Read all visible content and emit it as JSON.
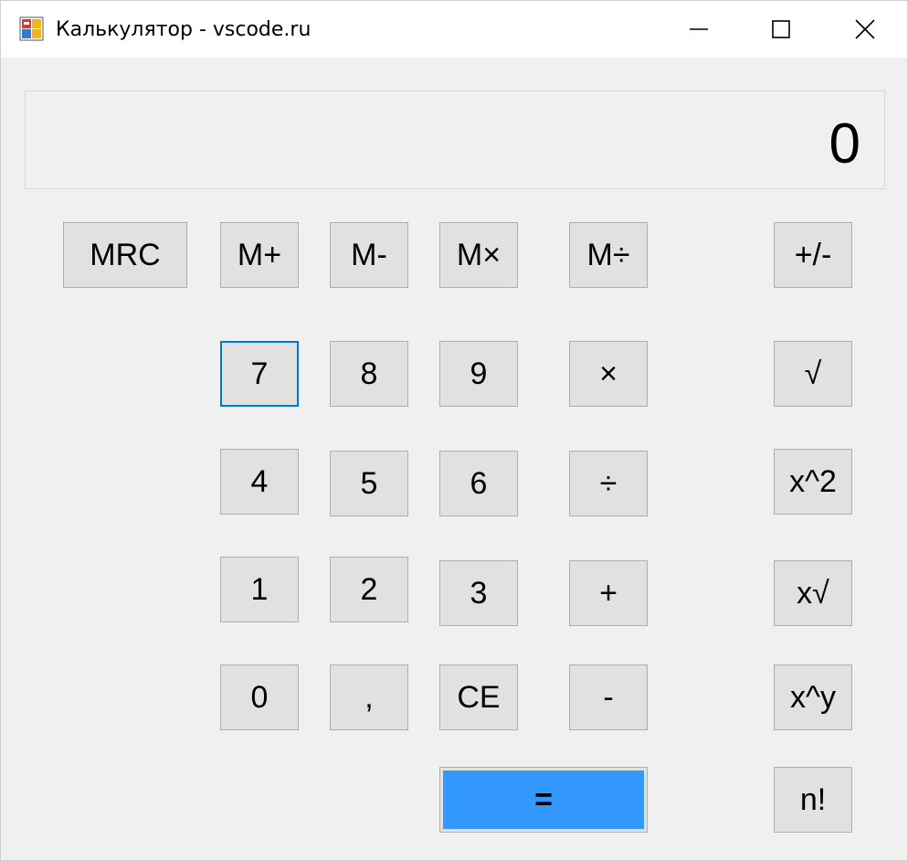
{
  "window": {
    "title": "Калькулятор - vscode.ru",
    "icon": "calculator-app-icon",
    "controls": {
      "minimize_icon": "minimize-icon",
      "maximize_icon": "maximize-icon",
      "close_icon": "close-icon"
    }
  },
  "display": {
    "value": "0"
  },
  "buttons": {
    "mrc": "MRC",
    "m_plus": "M+",
    "m_minus": "M-",
    "m_mul": "M×",
    "m_div": "M÷",
    "sign": "+/-",
    "d7": "7",
    "d8": "8",
    "d9": "9",
    "mul": "×",
    "sqrt": "√",
    "d4": "4",
    "d5": "5",
    "d6": "6",
    "div": "÷",
    "square": "x^2",
    "d1": "1",
    "d2": "2",
    "d3": "3",
    "plus": "+",
    "root": "x√",
    "d0": "0",
    "comma": ",",
    "ce": "CE",
    "minus": "-",
    "power": "x^y",
    "equals": "=",
    "factorial": "n!"
  },
  "colors": {
    "equals_accent": "#3399ff",
    "focus_border": "#0078d7",
    "button_face": "#e1e1e1",
    "window_bg": "#f0f0f0"
  }
}
